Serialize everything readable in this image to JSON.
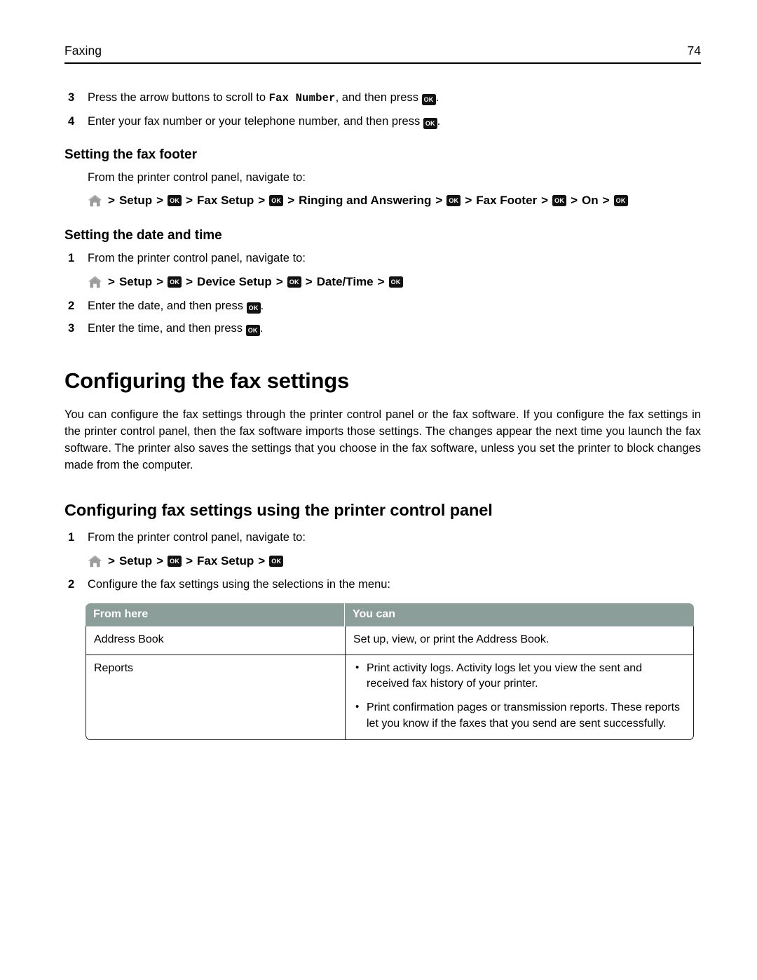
{
  "header": {
    "chapter": "Faxing",
    "page_number": "74"
  },
  "icons": {
    "home": "home-icon",
    "ok_key": "OK"
  },
  "top_steps": [
    {
      "num": "3",
      "text_before": "Press the arrow buttons to scroll to ",
      "literal": "Fax Number",
      "text_after": ", and then press ",
      "text_end": "."
    },
    {
      "num": "4",
      "text_before": "Enter your fax number or your telephone number, and then press ",
      "literal": "",
      "text_after": "",
      "text_end": "."
    }
  ],
  "fax_footer_section": {
    "heading": "Setting the fax footer",
    "intro": "From the printer control panel, navigate to:",
    "path": [
      "Setup",
      "Fax Setup",
      "Ringing and Answering",
      "Fax Footer",
      "On"
    ],
    "separator": ">"
  },
  "date_time_section": {
    "heading": "Setting the date and time",
    "steps": [
      {
        "num": "1",
        "text": "From the printer control panel, navigate to:"
      },
      {
        "num": "2",
        "text_before": "Enter the date, and then press ",
        "text_end": "."
      },
      {
        "num": "3",
        "text_before": "Enter the time, and then press ",
        "text_end": "."
      }
    ],
    "path": [
      "Setup",
      "Device Setup",
      "Date/Time"
    ]
  },
  "configuring_section": {
    "title": "Configuring the fax settings",
    "paragraph": "You can configure the fax settings through the printer control panel or the fax software. If you configure the fax settings in the printer control panel, then the fax software imports those settings. The changes appear the next time you launch the fax software. The printer also saves the settings that you choose in the fax software, unless you set the printer to block changes made from the computer."
  },
  "control_panel_section": {
    "title": "Configuring fax settings using the printer control panel",
    "steps": [
      {
        "num": "1",
        "text": "From the printer control panel, navigate to:"
      },
      {
        "num": "2",
        "text": "Configure the fax settings using the selections in the menu:"
      }
    ],
    "path": [
      "Setup",
      "Fax Setup"
    ]
  },
  "table": {
    "columns": [
      "From here",
      "You can"
    ],
    "header_bg": "#8b9e9a",
    "rows": [
      {
        "from_here": "Address Book",
        "you_can_text": "Set up, view, or print the Address Book.",
        "you_can_bullets": []
      },
      {
        "from_here": "Reports",
        "you_can_text": "",
        "you_can_bullets": [
          "Print activity logs. Activity logs let you view the sent and received fax history of your printer.",
          "Print confirmation pages or transmission reports. These reports let you know if the faxes that you send are sent successfully."
        ]
      }
    ]
  }
}
